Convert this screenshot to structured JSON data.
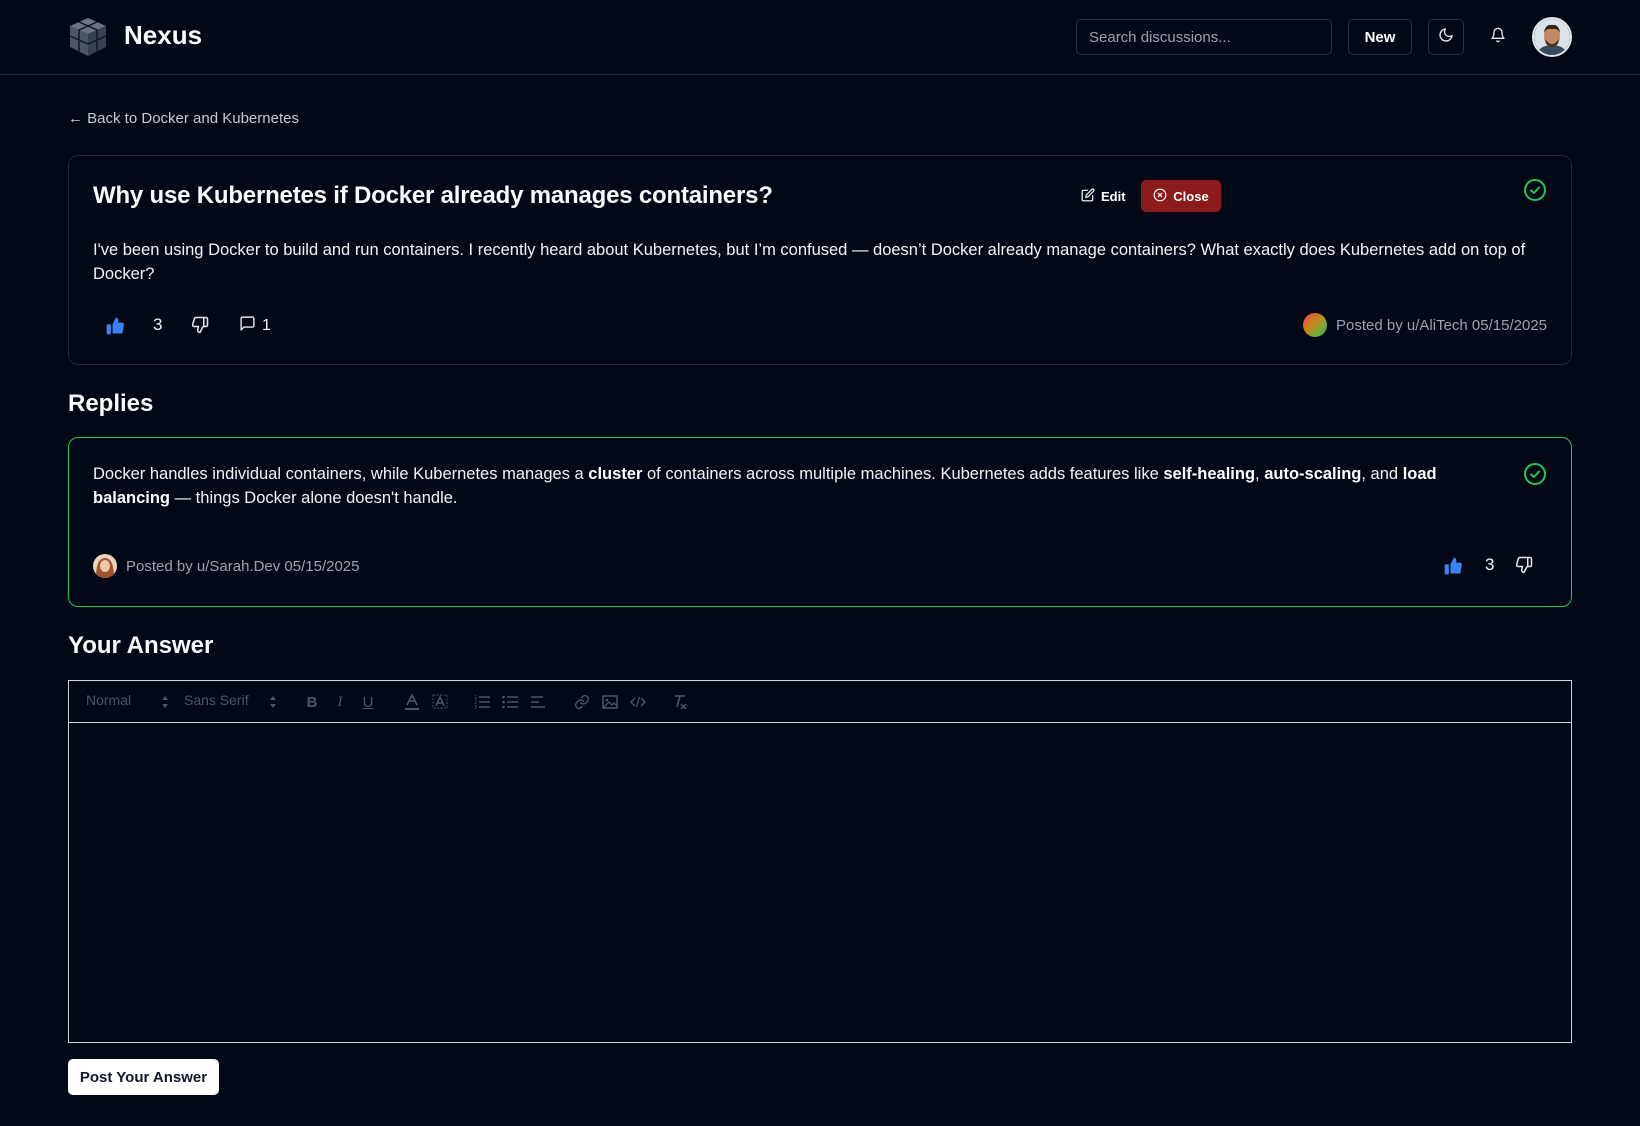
{
  "header": {
    "logo_text": "Nexus",
    "search_placeholder": "Search discussions...",
    "new_label": "New"
  },
  "back_link": "← Back to Docker and Kubernetes",
  "question": {
    "title": "Why use Kubernetes if Docker already manages containers?",
    "edit_label": "Edit",
    "close_label": "Close",
    "body": "I've been using Docker to build and run containers. I recently heard about Kubernetes, but I’m confused — doesn’t Docker already manage containers? What exactly does Kubernetes add on top of Docker?",
    "votes": "3",
    "comment_count": "1",
    "meta": "Posted by u/AliTech 05/15/2025"
  },
  "replies_heading": "Replies",
  "reply": {
    "body_segments": [
      {
        "text": "Docker handles individual containers, while Kubernetes manages a ",
        "bold": false
      },
      {
        "text": "cluster",
        "bold": true
      },
      {
        "text": " of containers across multiple machines. Kubernetes adds features like ",
        "bold": false
      },
      {
        "text": "self-healing",
        "bold": true
      },
      {
        "text": ", ",
        "bold": false
      },
      {
        "text": "auto-scaling",
        "bold": true
      },
      {
        "text": ", and ",
        "bold": false
      },
      {
        "text": "load balancing",
        "bold": true
      },
      {
        "text": " — things Docker alone doesn't handle.",
        "bold": false
      }
    ],
    "meta": "Posted by u/Sarah.Dev 05/15/2025",
    "votes": "3"
  },
  "answer": {
    "heading": "Your Answer",
    "format_select": "Normal",
    "font_select": "Sans Serif",
    "post_label": "Post Your Answer"
  },
  "colors": {
    "background": "#030816",
    "accent_blue": "#3b82f6",
    "success_green": "#22c55e",
    "danger_red": "#8b1a1a"
  },
  "icons": {
    "logo": "cube-logo-icon",
    "theme": "moon-icon",
    "notifications": "bell-icon",
    "edit": "edit-icon",
    "close": "x-circle-icon",
    "accepted": "check-circle-icon",
    "upvote": "thumbs-up-icon",
    "downvote": "thumbs-down-icon",
    "comments": "message-square-icon"
  }
}
